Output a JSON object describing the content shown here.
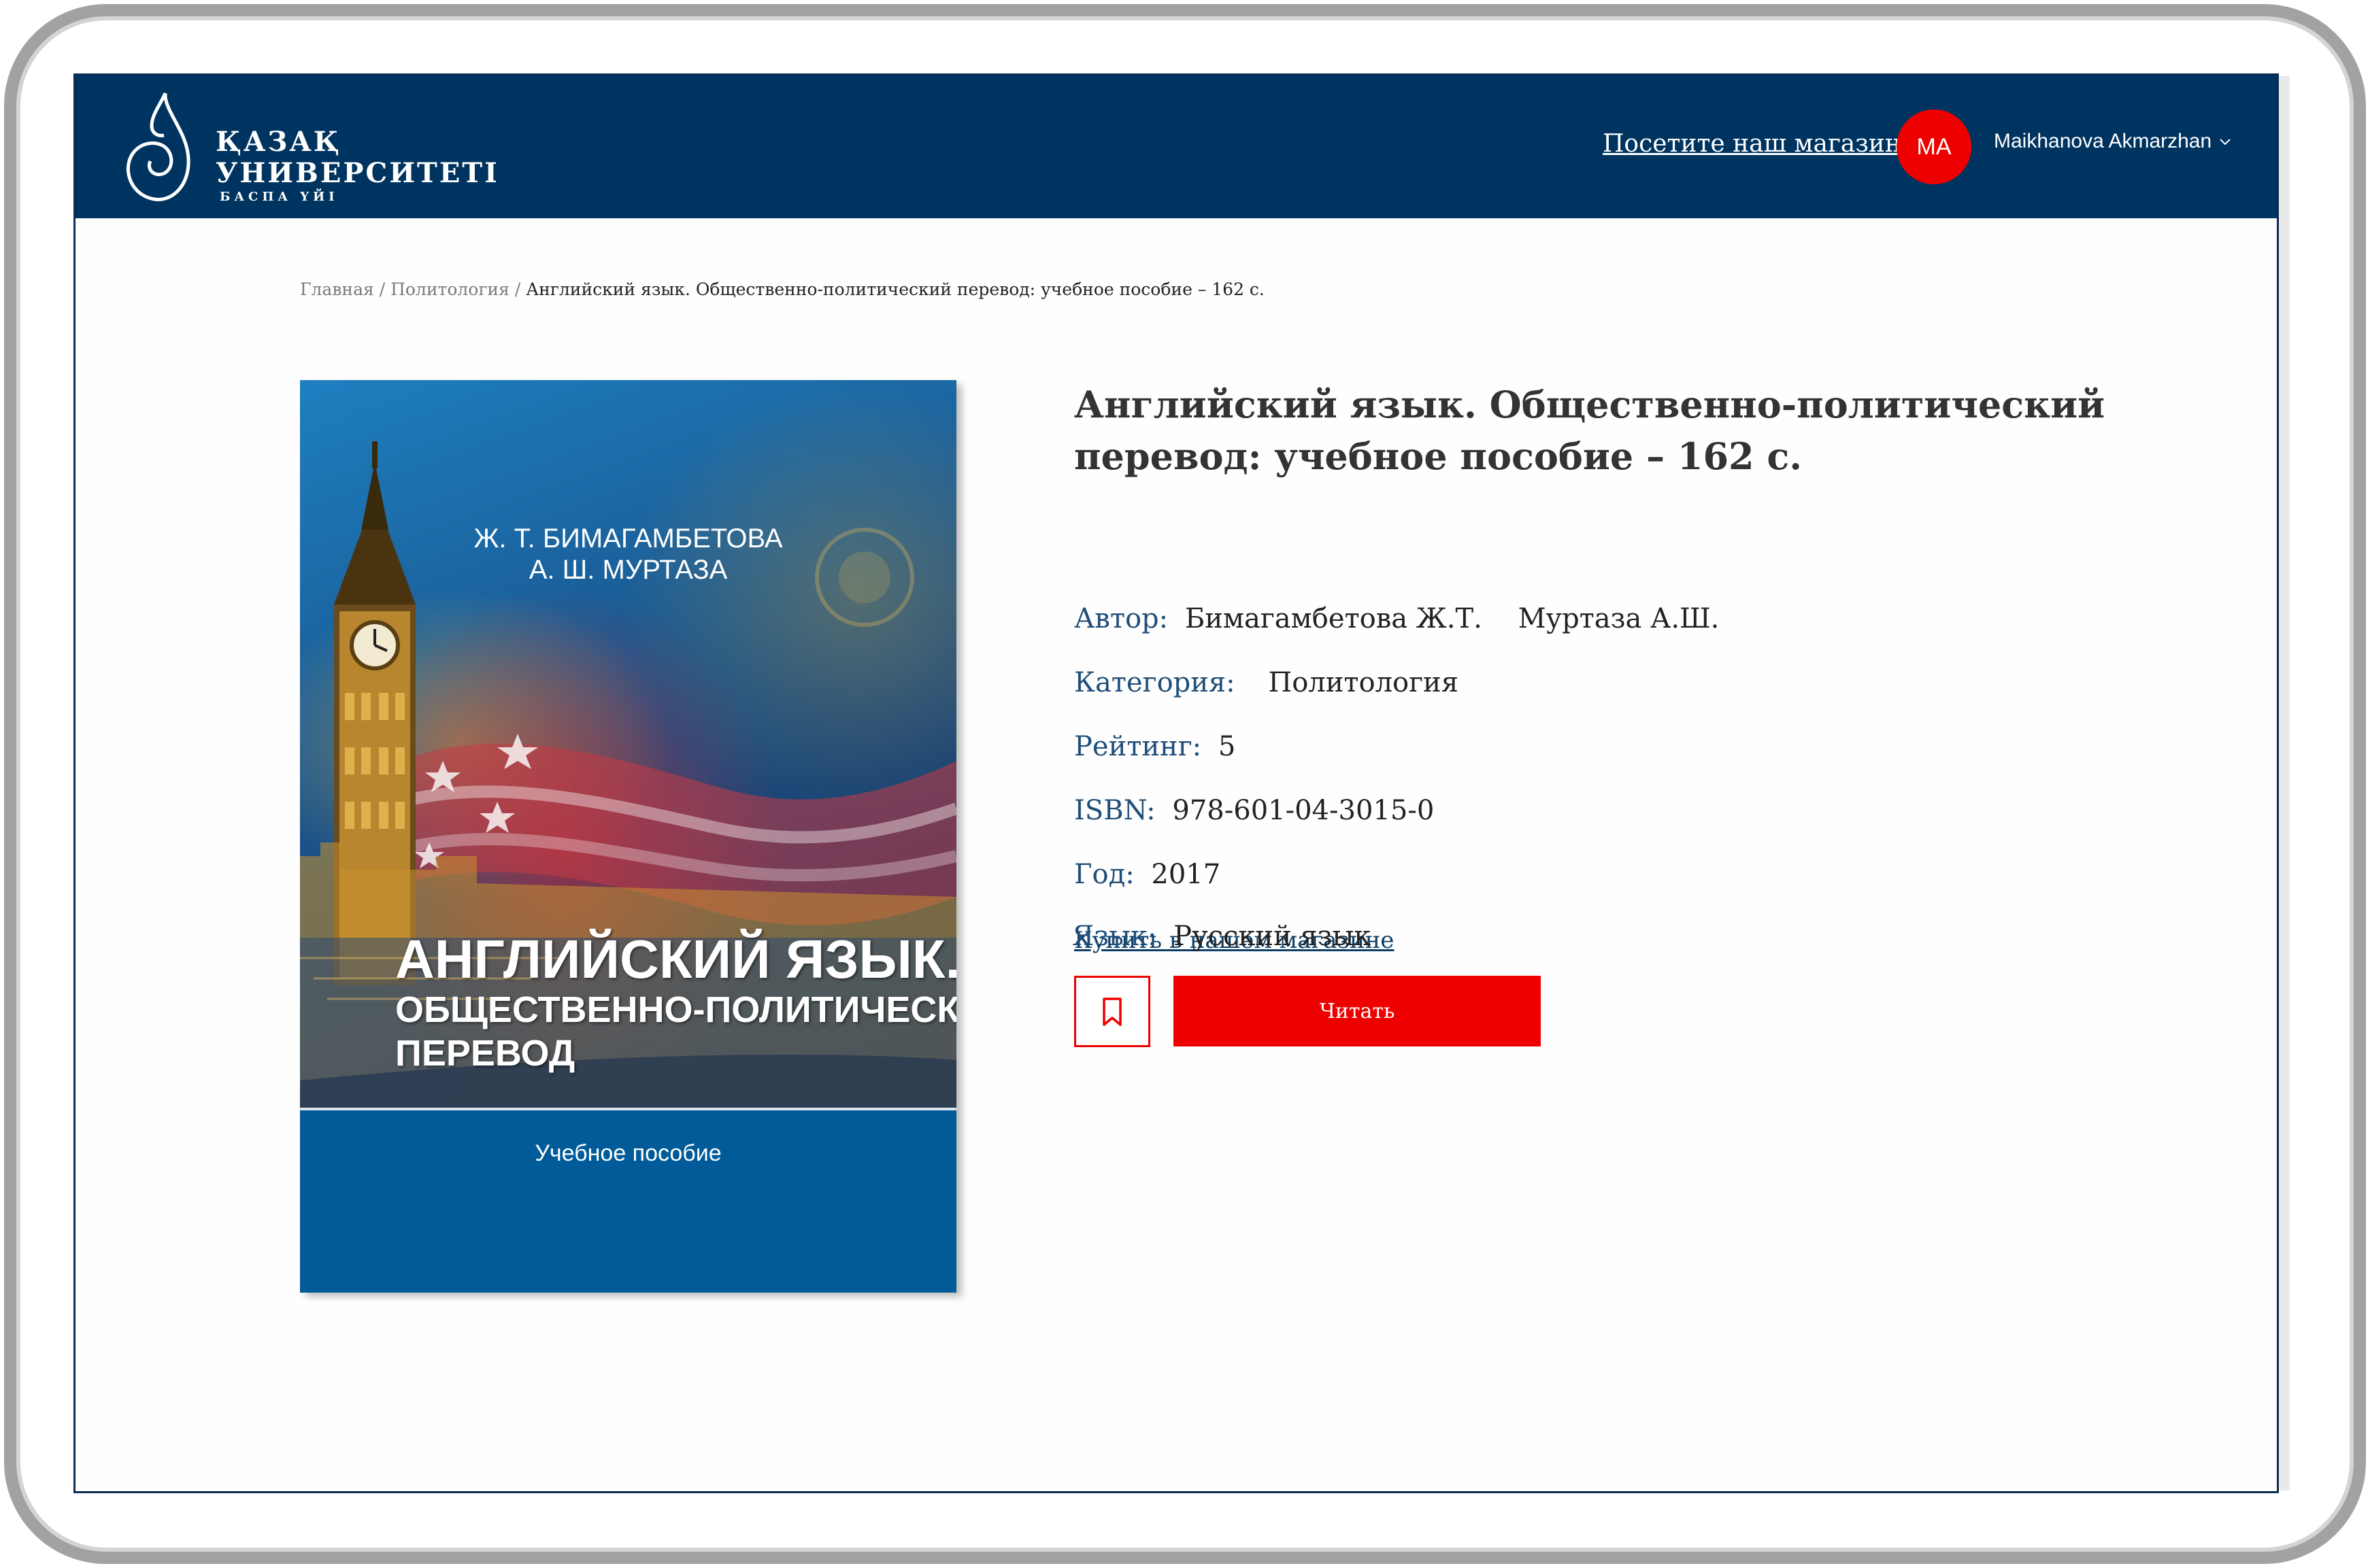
{
  "header": {
    "logo": {
      "line1": "ҚАЗАҚ",
      "line2": "УНИВЕРСИТЕТІ",
      "line3": "БАСПА ҮЙІ"
    },
    "shop_link": "Посетите наш магазин",
    "avatar_initials": "MA",
    "user_name": "Maikhanova Akmarzhan"
  },
  "breadcrumb": {
    "home": "Главная",
    "category": "Политология",
    "current": "Английский язык. Общественно-политический перевод: учебное пособие – 162 с.",
    "separator": "/"
  },
  "cover": {
    "authors": [
      "Ж. Т. БИМАГАМБЕТОВА",
      "А. Ш. МУРТАЗА"
    ],
    "title_lines": [
      "АНГЛИЙСКИЙ ЯЗЫК.",
      "ОБЩЕСТВЕННО-ПОЛИТИЧЕСКИЙ",
      "ПЕРЕВОД"
    ],
    "type": "Учебное пособие"
  },
  "book": {
    "title": "Английский язык. Общественно-политический перевод: учебное пособие – 162 с.",
    "author_label": "Автор:",
    "authors": [
      "Бимагамбетова Ж.Т.",
      "Муртаза А.Ш."
    ],
    "category_label": "Категория:",
    "category": "Политология",
    "rating_label": "Рейтинг:",
    "rating": "5",
    "isbn_label": "ISBN:",
    "isbn": "978-601-04-3015-0",
    "year_label": "Год:",
    "year": "2017",
    "language_label": "Язык:",
    "language": "Русский язык"
  },
  "actions": {
    "buy_link": "Купить в нашем магазине",
    "read_button": "Читать",
    "bookmark_icon": "bookmark-icon"
  },
  "colors": {
    "header_bg": "#003460",
    "accent_red": "#ee0000",
    "label_blue": "#1f4e79",
    "cover_band": "#005b98"
  }
}
